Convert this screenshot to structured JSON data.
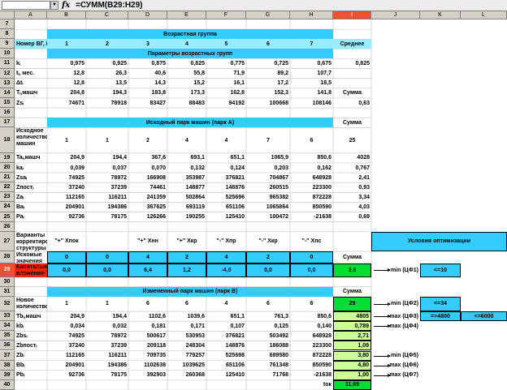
{
  "formula_bar": {
    "name_box": "",
    "fx": "fx",
    "formula": "=СУММ(B29:H29)"
  },
  "columns": [
    "A",
    "B",
    "C",
    "D",
    "E",
    "F",
    "G",
    "H",
    "I",
    "J",
    "K",
    "L"
  ],
  "rows_numbers": [
    "7",
    "8",
    "9",
    "10",
    "11",
    "12",
    "13",
    "14",
    "15",
    "16",
    "17",
    "18",
    "19",
    "20",
    "21",
    "22",
    "23",
    "24",
    "25",
    "26",
    "27",
    "28",
    "29",
    "30",
    "31",
    "32",
    "33",
    "34",
    "35",
    "36",
    "37",
    "38",
    "39",
    "40"
  ],
  "r8": {
    "title": "Возрастная группа"
  },
  "r9": {
    "label": "Номер ВГ, i",
    "vals": [
      "1",
      "2",
      "3",
      "4",
      "5",
      "6",
      "7"
    ],
    "sum": "Среднее"
  },
  "r10": {
    "title": "Параметры возрастных групп"
  },
  "r11": {
    "label": "kᵢ",
    "vals": [
      "0,975",
      "0,925",
      "0,875",
      "0,825",
      "0,775",
      "0,725",
      "0,675"
    ],
    "sum": "0,825"
  },
  "r12": {
    "label": "tᵢ, мес.",
    "vals": [
      "12,8",
      "26,3",
      "40,6",
      "55,8",
      "71,9",
      "89,2",
      "107,7"
    ]
  },
  "r13": {
    "label": "Δtᵢ",
    "vals": [
      "12,8",
      "13,5",
      "14,3",
      "15,2",
      "16,1",
      "17,2",
      "18,5"
    ]
  },
  "r14": {
    "label": "Tᵢ,машч",
    "vals": [
      "204,8",
      "194,3",
      "183,8",
      "173,3",
      "162,8",
      "152,3",
      "141,8"
    ],
    "sum": "Сумма"
  },
  "r15": {
    "label": "Zsᵢ",
    "vals": [
      "74671",
      "78918",
      "83427",
      "88483",
      "94192",
      "100668",
      "108146"
    ],
    "sum": "0,63"
  },
  "r17": {
    "title": "Исходный парк машин (парк А)",
    "sum": "Сумма"
  },
  "r18": {
    "label": "Исходное количество машин",
    "vals": [
      "1",
      "1",
      "2",
      "4",
      "4",
      "7",
      "6"
    ],
    "sum": "25"
  },
  "r19": {
    "label": "Taᵢ,машч",
    "vals": [
      "204,9",
      "194,4",
      "367,6",
      "693,1",
      "651,1",
      "1065,9",
      "850,6"
    ],
    "sum": "4028"
  },
  "r20": {
    "label": "kaᵢ",
    "vals": [
      "0,039",
      "0,037",
      "0,070",
      "0,132",
      "0,124",
      "0,203",
      "0,162"
    ],
    "sum": "0,767"
  },
  "r21": {
    "label": "Zsaᵢ",
    "vals": [
      "74925",
      "78972",
      "166908",
      "353987",
      "376821",
      "704867",
      "648928"
    ],
    "sum": "2,41"
  },
  "r22": {
    "label": "Zпостᵢ",
    "vals": [
      "37240",
      "37239",
      "74461",
      "148877",
      "148876",
      "260515",
      "223300"
    ],
    "sum": "0,93"
  },
  "r23": {
    "label": "Zaᵢ",
    "vals": [
      "112165",
      "116211",
      "241359",
      "502864",
      "525696",
      "965382",
      "872228"
    ],
    "sum": "3,34"
  },
  "r24": {
    "label": "Baᵢ",
    "vals": [
      "204901",
      "194386",
      "367625",
      "693119",
      "651106",
      "1065864",
      "850590"
    ],
    "sum": "4,03"
  },
  "r25": {
    "label": "Paᵢ",
    "vals": [
      "92736",
      "78175",
      "126266",
      "190255",
      "125410",
      "100472",
      "-21638"
    ],
    "sum": "0,69"
  },
  "r27": {
    "label": "Варианты корректировки структуры",
    "vals": [
      "\"+\" Xпок",
      "",
      "\"+\" Xнн",
      "\"+\" Xкр",
      "\"-\" Xпр",
      "\"-\" Xкр",
      "\"-\" Xпс"
    ],
    "opt": "Условия оптимизации"
  },
  "r28": {
    "label": "Искомые значения",
    "vals": [
      "0",
      "0",
      "4",
      "2",
      "4",
      "2",
      "0"
    ],
    "sum": "Сумма"
  },
  "r29": {
    "label": "Капитальные вложения·10⁻⁶",
    "vals": [
      "0,0",
      "0,0",
      "6,4",
      "1,2",
      "-4,0",
      "0,0",
      "0,0"
    ],
    "sum": "3,6",
    "target": "min (ЦФ1)",
    "cond": "<=10"
  },
  "r31": {
    "title": "Измененный парк машин (парк B)",
    "sum": "Сумма"
  },
  "r32": {
    "label": "Новое количество машин",
    "vals": [
      "1",
      "1",
      "6",
      "6",
      "4",
      "6",
      "6"
    ],
    "sum": "29",
    "target": "min (ЦФ2)",
    "cond": "<=34"
  },
  "r33": {
    "label": "Tbᵢ,машч",
    "vals": [
      "204,9",
      "194,4",
      "1102,6",
      "1039,6",
      "651,1",
      "761,3",
      "850,6"
    ],
    "sum": "4805",
    "target": "max (ЦФ3)",
    "cond": "=>4800",
    "cond2": "<=6000"
  },
  "r34": {
    "label": "kbᵢ",
    "vals": [
      "0,034",
      "0,032",
      "0,181",
      "0,171",
      "0,107",
      "0,125",
      "0,140"
    ],
    "sum": "0,789",
    "target": "max (ЦФ4)"
  },
  "r35": {
    "label": "Zbsᵢ",
    "vals": [
      "74925",
      "78972",
      "500617",
      "530953",
      "376821",
      "503492",
      "648928"
    ],
    "sum": "2,71"
  },
  "r36": {
    "label": "Zbпостᵢ",
    "vals": [
      "37240",
      "37239",
      "209118",
      "248304",
      "148876",
      "186088",
      "223300"
    ],
    "sum": "1,09"
  },
  "r37": {
    "label": "Zbᵢ",
    "vals": [
      "112165",
      "116211",
      "709735",
      "779257",
      "525698",
      "689580",
      "872228"
    ],
    "sum": "3,80",
    "target": "min (ЦФ5)"
  },
  "r38": {
    "label": "Bbᵢ",
    "vals": [
      "204901",
      "194386",
      "1102638",
      "1039625",
      "651106",
      "761348",
      "850590"
    ],
    "sum": "4,80",
    "target": "max (ЦФ6)"
  },
  "r39": {
    "label": "Pbᵢ",
    "vals": [
      "92736",
      "78175",
      "392903",
      "260368",
      "125410",
      "71768",
      "-21638"
    ],
    "sum": "1,00",
    "target": "max (ЦФ7)"
  },
  "r40": {
    "h": "tок",
    "sum": "11,69"
  }
}
